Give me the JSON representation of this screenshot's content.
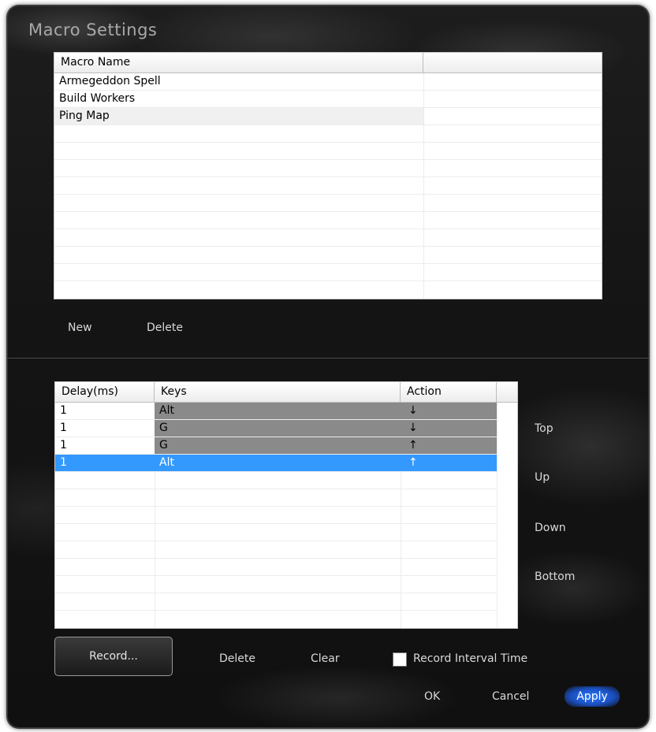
{
  "window": {
    "title": "Macro Settings"
  },
  "macro_list": {
    "header": "Macro Name",
    "items": [
      "Armegeddon Spell",
      "Build Workers",
      "Ping Map"
    ]
  },
  "macro_buttons": {
    "new": "New",
    "delete": "Delete"
  },
  "event_list": {
    "headers": {
      "delay": "Delay(ms)",
      "keys": "Keys",
      "action": "Action"
    },
    "rows": [
      {
        "delay": "1",
        "key": "Alt",
        "action": "↓"
      },
      {
        "delay": "1",
        "key": "G",
        "action": "↓"
      },
      {
        "delay": "1",
        "key": "G",
        "action": "↑"
      },
      {
        "delay": "1",
        "key": "Alt",
        "action": "↑"
      }
    ]
  },
  "move_buttons": {
    "top": "Top",
    "up": "Up",
    "down": "Down",
    "bottom": "Bottom"
  },
  "record_controls": {
    "record": "Record...",
    "delete": "Delete",
    "clear": "Clear",
    "interval_label": "Record Interval Time"
  },
  "dialog_buttons": {
    "ok": "OK",
    "cancel": "Cancel",
    "apply": "Apply"
  },
  "colors": {
    "selected_row": "#3399ff",
    "key_cell": "#8a8a8a",
    "apply_glow": "#2d7bff"
  }
}
